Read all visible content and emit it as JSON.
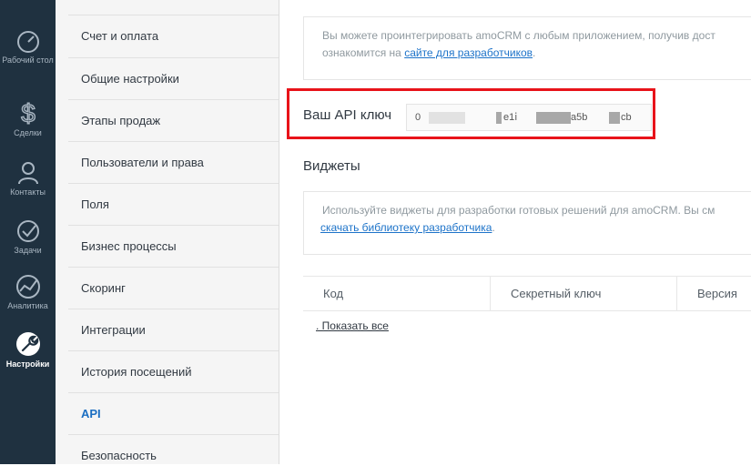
{
  "rail": {
    "items": [
      {
        "label": "Рабочий стол",
        "icon": "dashboard-icon"
      },
      {
        "label": "Сделки",
        "icon": "dollar-icon"
      },
      {
        "label": "Контакты",
        "icon": "contact-icon"
      },
      {
        "label": "Задачи",
        "icon": "check-icon"
      },
      {
        "label": "Аналитика",
        "icon": "analytics-icon"
      },
      {
        "label": "Настройки",
        "icon": "wrench-icon"
      }
    ]
  },
  "submenu": {
    "items": [
      {
        "label": "Счет и оплата"
      },
      {
        "label": "Общие настройки"
      },
      {
        "label": "Этапы продаж"
      },
      {
        "label": "Пользователи и права"
      },
      {
        "label": "Поля"
      },
      {
        "label": "Бизнес процессы"
      },
      {
        "label": "Скоринг"
      },
      {
        "label": "Интеграции"
      },
      {
        "label": "История посещений"
      },
      {
        "label": "API"
      },
      {
        "label": "Безопасность"
      }
    ],
    "active": "API"
  },
  "main": {
    "intro_text": "Вы можете проинтегрировать amoCRM с любым приложением, получив дост",
    "intro_text2": "ознакомится на ",
    "intro_link": "сайте для разработчиков",
    "intro_tail": ".",
    "api_label": "Ваш API ключ",
    "api_key_parts": [
      "0",
      "e1ⅰ",
      "a5b",
      "cb"
    ],
    "widgets_title": "Виджеты",
    "widgets_text": "Используйте виджеты для разработки готовых решений для amoCRM. Вы см",
    "widgets_link": "скачать библиотеку разработчика",
    "widgets_tail": ".",
    "table_headers": [
      "Код",
      "Секретный ключ",
      "Версия"
    ],
    "show_all": ". Показать все"
  },
  "colors": {
    "rail_bg": "#1f3140",
    "active_link": "#1b6ec2",
    "highlight": "#e8131a"
  }
}
